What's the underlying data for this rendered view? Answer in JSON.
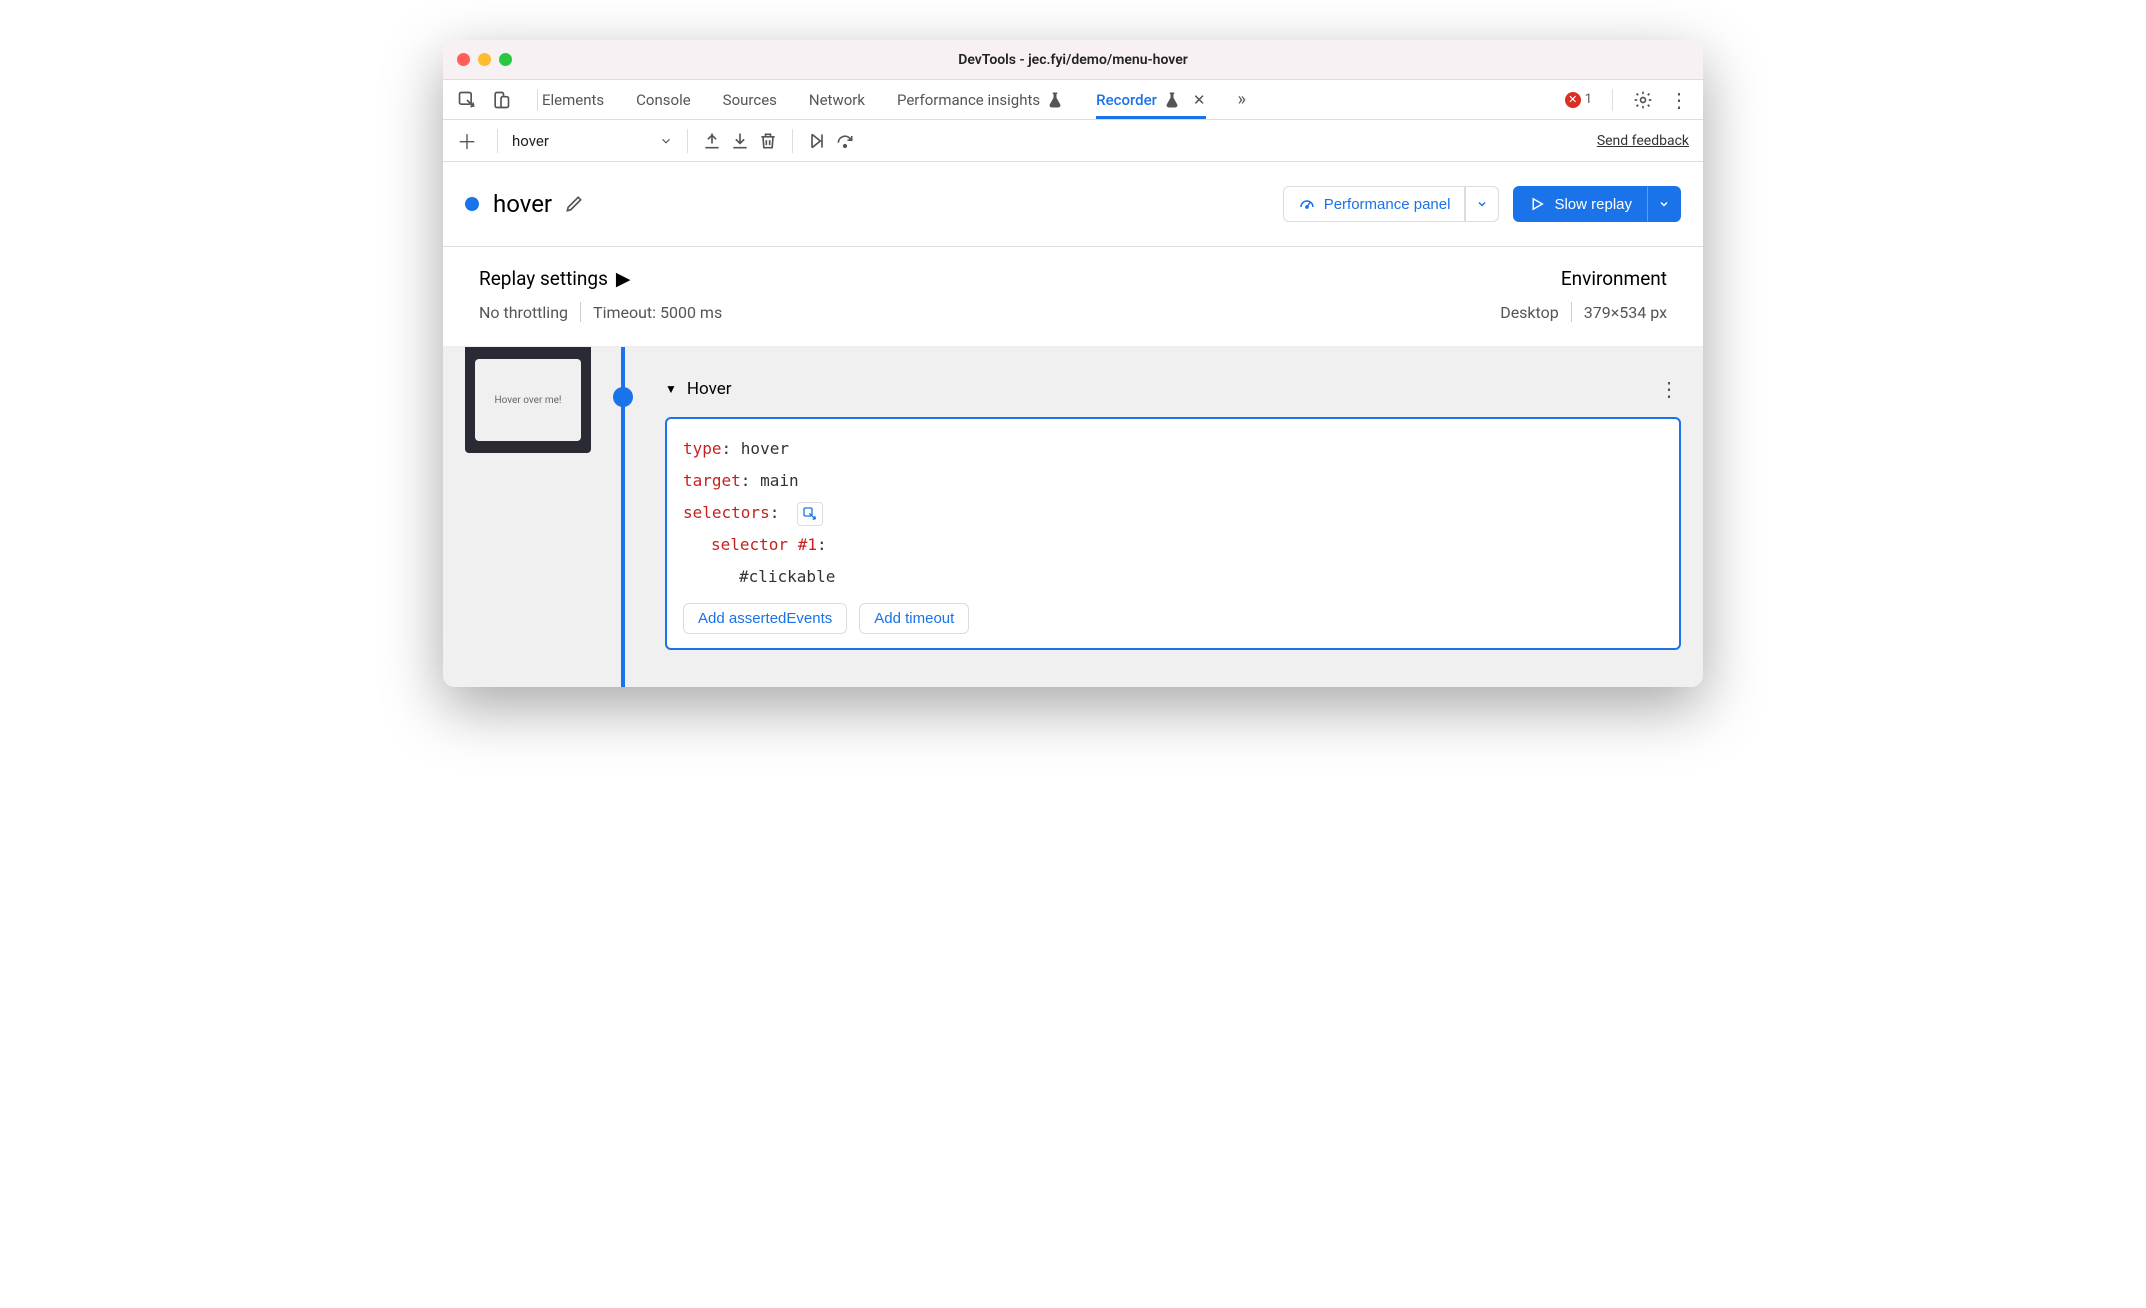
{
  "window": {
    "title": "DevTools - jec.fyi/demo/menu-hover"
  },
  "tabs": {
    "elements": "Elements",
    "console": "Console",
    "sources": "Sources",
    "network": "Network",
    "perf_insights": "Performance insights",
    "recorder": "Recorder",
    "more": "»"
  },
  "errors": {
    "count": "1"
  },
  "toolbar": {
    "recording_name": "hover",
    "feedback": "Send feedback"
  },
  "recording": {
    "title": "hover",
    "perf_panel": "Performance panel",
    "slow_replay": "Slow replay"
  },
  "settings": {
    "replay_heading": "Replay settings",
    "throttling": "No throttling",
    "timeout": "Timeout: 5000 ms",
    "env_heading": "Environment",
    "device": "Desktop",
    "dimensions": "379×534 px"
  },
  "thumb": {
    "label": "Hover over me!"
  },
  "step": {
    "title": "Hover",
    "type_key": "type",
    "type_val": "hover",
    "target_key": "target",
    "target_val": "main",
    "selectors_key": "selectors",
    "selector1_key": "selector #1",
    "selector1_val": "#clickable",
    "add_asserted": "Add assertedEvents",
    "add_timeout": "Add timeout"
  }
}
